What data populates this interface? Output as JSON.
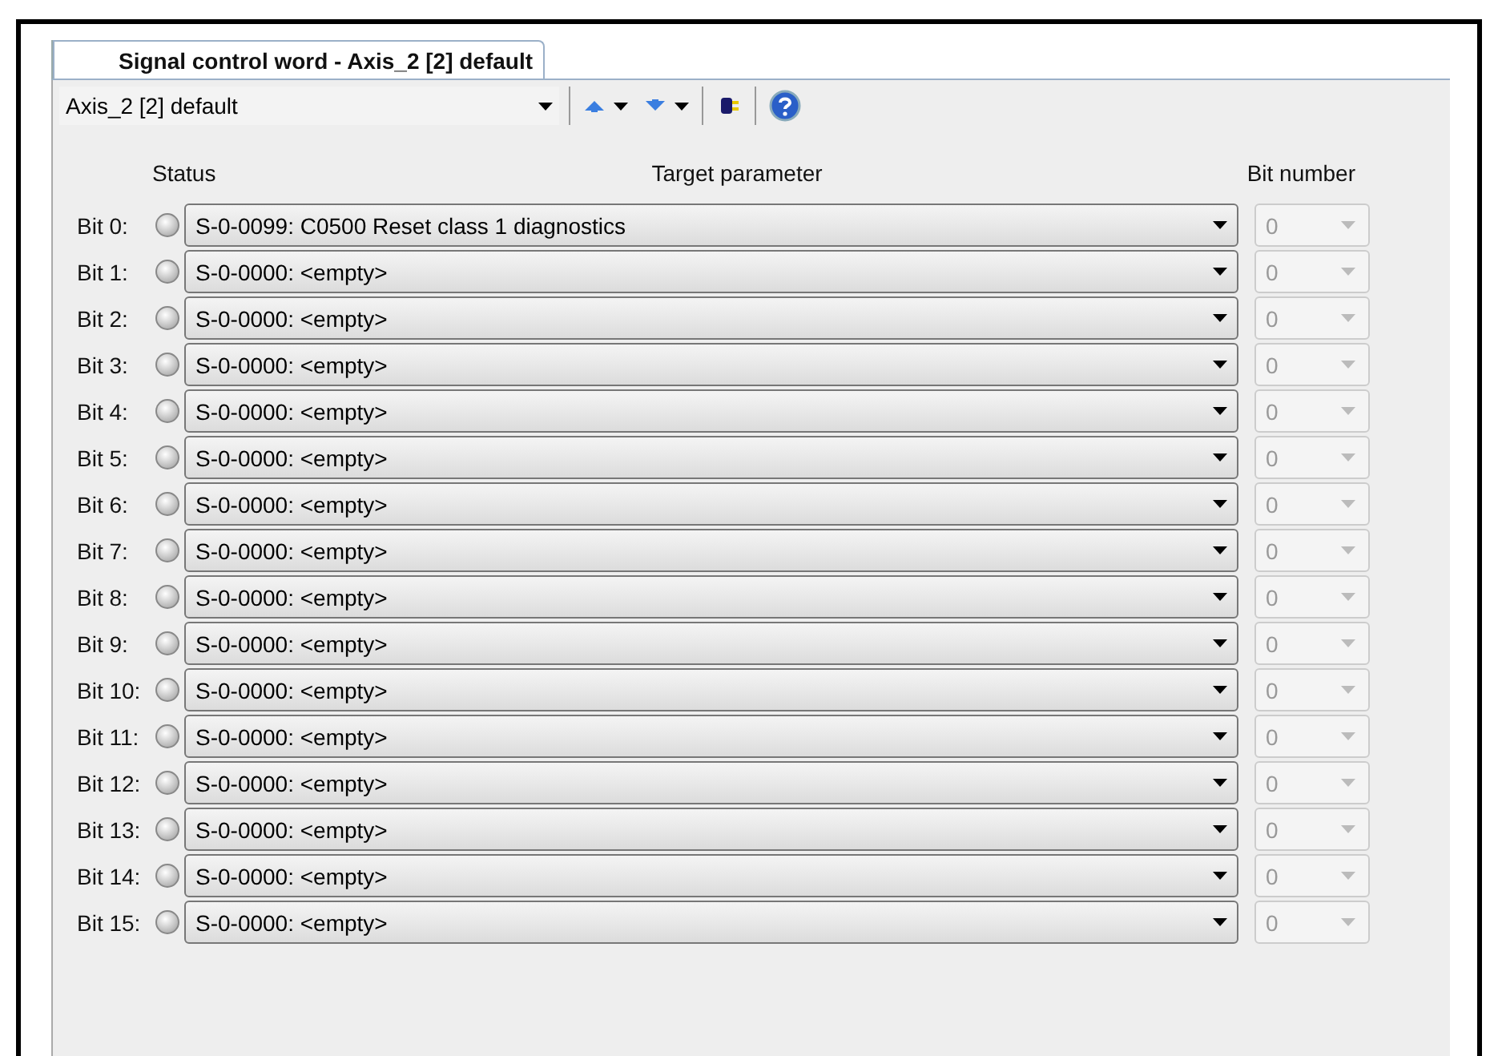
{
  "tab": {
    "title": "Signal control word - Axis_2 [2] default",
    "selected": true
  },
  "toolbar": {
    "axis_selector": "Axis_2 [2] default"
  },
  "headers": {
    "status": "Status",
    "target": "Target parameter",
    "bit_number": "Bit number"
  },
  "rows": [
    {
      "label": "Bit 0:",
      "active": false,
      "parameter": "S-0-0099: C0500 Reset class 1 diagnostics",
      "bit": "0",
      "disabled": true
    },
    {
      "label": "Bit 1:",
      "active": false,
      "parameter": "S-0-0000: <empty>",
      "bit": "0",
      "disabled": true
    },
    {
      "label": "Bit 2:",
      "active": false,
      "parameter": "S-0-0000: <empty>",
      "bit": "0",
      "disabled": true
    },
    {
      "label": "Bit 3:",
      "active": false,
      "parameter": "S-0-0000: <empty>",
      "bit": "0",
      "disabled": true
    },
    {
      "label": "Bit 4:",
      "active": false,
      "parameter": "S-0-0000: <empty>",
      "bit": "0",
      "disabled": true
    },
    {
      "label": "Bit 5:",
      "active": false,
      "parameter": "S-0-0000: <empty>",
      "bit": "0",
      "disabled": true
    },
    {
      "label": "Bit 6:",
      "active": false,
      "parameter": "S-0-0000: <empty>",
      "bit": "0",
      "disabled": true
    },
    {
      "label": "Bit 7:",
      "active": false,
      "parameter": "S-0-0000: <empty>",
      "bit": "0",
      "disabled": true
    },
    {
      "label": "Bit 8:",
      "active": false,
      "parameter": "S-0-0000: <empty>",
      "bit": "0",
      "disabled": true
    },
    {
      "label": "Bit 9:",
      "active": false,
      "parameter": "S-0-0000: <empty>",
      "bit": "0",
      "disabled": true
    },
    {
      "label": "Bit 10:",
      "active": false,
      "parameter": "S-0-0000: <empty>",
      "bit": "0",
      "disabled": true
    },
    {
      "label": "Bit 11:",
      "active": false,
      "parameter": "S-0-0000: <empty>",
      "bit": "0",
      "disabled": true
    },
    {
      "label": "Bit 12:",
      "active": false,
      "parameter": "S-0-0000: <empty>",
      "bit": "0",
      "disabled": true
    },
    {
      "label": "Bit 13:",
      "active": false,
      "parameter": "S-0-0000: <empty>",
      "bit": "0",
      "disabled": true
    },
    {
      "label": "Bit 14:",
      "active": false,
      "parameter": "S-0-0000: <empty>",
      "bit": "0",
      "disabled": true
    },
    {
      "label": "Bit 15:",
      "active": false,
      "parameter": "S-0-0000: <empty>",
      "bit": "0",
      "disabled": true
    }
  ]
}
